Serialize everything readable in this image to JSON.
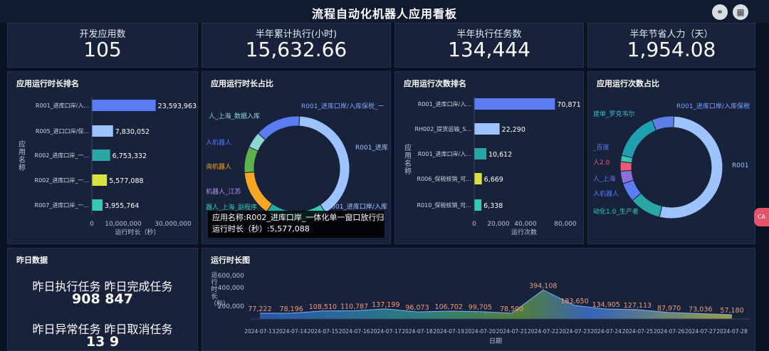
{
  "header": {
    "title": "流程自动化机器人应用看板",
    "icons": [
      "link-icon",
      "grid-icon"
    ]
  },
  "kpis": [
    {
      "label": "开发应用数",
      "value": "105"
    },
    {
      "label": "半年累计执行(小时)",
      "value": "15,632.66"
    },
    {
      "label": "半年执行任务数",
      "value": "134,444"
    },
    {
      "label": "半年节省人力（天）",
      "value": "1,954.08"
    }
  ],
  "runtime_rank": {
    "title": "应用运行时长排名",
    "ylabel": "应用名称",
    "xlabel": "运行时长（秒）",
    "x_ticks": [
      "0",
      "10,000,000",
      "30,000,000"
    ],
    "colors": [
      "#5b7cf2",
      "#9cc3ff",
      "#2aa7a5",
      "#d9e13f",
      "#35c9b4"
    ]
  },
  "runtime_share": {
    "title": "应用运行时长占比",
    "labels": [
      "R001_进库口岸/入库保税_一",
      "R001_进库",
      "R001_进库口岸/入库",
      "人_上海_数据入库",
      "入机器人",
      "询机器人",
      "机器人_江苏",
      "器人_上海_副程序"
    ]
  },
  "tooltip": {
    "line1": "应用名称:R002_进库口岸_一体化单一窗口放行归档",
    "line2": "运行时长（秒）:5,577,088"
  },
  "count_rank": {
    "title": "应用运行次数排名",
    "ylabel": "应用名称",
    "xlabel": "运行次数",
    "x_ticks": [
      "0",
      "20,000",
      "40,000",
      "80,000"
    ],
    "colors": [
      "#5b7cf2",
      "#9cc3ff",
      "#2aa7a5",
      "#d9e13f",
      "#35c9b4"
    ]
  },
  "count_share": {
    "title": "应用运行次数占比",
    "labels": [
      "R001_进库口岸/入库保税",
      "R001",
      "建单_罗克韦尔",
      "_百度",
      "人2.0",
      "人_上海",
      "入机器人",
      "动化1.0_生产者"
    ]
  },
  "yesterday": {
    "title": "昨日数据",
    "row1_label": "昨日执行任务 昨日完成任务",
    "row1_value": "908 847",
    "row2_label": "昨日异常任务 昨日取消任务",
    "row2_value": "13 9"
  },
  "trend": {
    "title": "运行时长图",
    "ylabel": "运行时长（秒）",
    "xlabel": "日期",
    "y_ticks": [
      "200,000",
      "400,000",
      "600,000"
    ]
  },
  "chart_data": [
    {
      "type": "bar",
      "title": "应用运行时长排名",
      "xlabel": "运行时长（秒）",
      "ylabel": "应用名称",
      "categories": [
        "R001_进库口岸/入...",
        "R005_进口口岸/保...",
        "R002_进库口岸_一...",
        "R002_进库口岸_一...",
        "R007_进库口岸_一..."
      ],
      "values": [
        23593963,
        7830052,
        6753332,
        5577088,
        3955764
      ],
      "labels": [
        "23,593,963",
        "7,830,052",
        "6,753,332",
        "5,577,088",
        "3,955,764"
      ],
      "xlim": [
        0,
        30000000
      ]
    },
    {
      "type": "pie",
      "title": "应用运行时长占比",
      "labels": [
        "R001_进库",
        "器人_上海_副程序",
        "机器人_江苏",
        "询机器人",
        "入机器人",
        "人_上海_数据入库",
        "R001_进库口岸/入库保税_一"
      ],
      "values": [
        40,
        9,
        10,
        14,
        8,
        5,
        14
      ],
      "colors": [
        "#9cc3ff",
        "#35c9b4",
        "#2aa7a5",
        "#f5a623",
        "#5fb14e",
        "#8ad8d0",
        "#5b7cf2"
      ]
    },
    {
      "type": "bar",
      "title": "应用运行次数排名",
      "xlabel": "运行次数",
      "ylabel": "应用名称",
      "categories": [
        "R001_进库口岸/入...",
        "RH002_提货运输_S...",
        "R001_进库口岸/入...",
        "R006_保税核销_可...",
        "R010_保税核销_可..."
      ],
      "values": [
        70871,
        22290,
        10612,
        6669,
        6338
      ],
      "labels": [
        "70,871",
        "22,290",
        "10,612",
        "6,669",
        "6,338"
      ],
      "xlim": [
        0,
        80000
      ]
    },
    {
      "type": "pie",
      "title": "应用运行次数占比",
      "labels": [
        "R001",
        "动化1.0_生产者",
        "入机器人",
        "人_上海",
        "人2.0",
        "_百度",
        "建单_罗克韦尔",
        "R001_进库口岸/入库保税"
      ],
      "values": [
        53,
        10,
        6,
        4,
        3,
        2,
        15,
        7
      ],
      "colors": [
        "#9cc3ff",
        "#2aa7a5",
        "#5b7cf2",
        "#8d6fd8",
        "#f05a7a",
        "#35c9b4",
        "#1f9fb0",
        "#5f7fe8"
      ]
    },
    {
      "type": "area",
      "title": "运行时长图",
      "xlabel": "日期",
      "ylabel": "运行时长（秒）",
      "x": [
        "2024-07-13",
        "2024-07-14",
        "2024-07-15",
        "2024-07-16",
        "2024-07-17",
        "2024-07-18",
        "2024-07-19",
        "2024-07-20",
        "2024-07-21",
        "2024-07-22",
        "2024-07-23",
        "2024-07-24",
        "2024-07-25",
        "2024-07-26",
        "2024-07-27",
        "2024-07-28"
      ],
      "values": [
        77222,
        78196,
        108510,
        110787,
        137199,
        96073,
        106702,
        99705,
        78500,
        394108,
        183650,
        134905,
        127113,
        87970,
        73036,
        57180
      ],
      "labels": [
        "77,222",
        "78,196",
        "108,510",
        "110,787",
        "137,199",
        "96,073",
        "106,702",
        "99,705",
        "78,500",
        "394,108",
        "183,650",
        "134,905",
        "127,113",
        "87,970",
        "73,036",
        "57,180"
      ],
      "ylim": [
        0,
        600000
      ]
    }
  ]
}
